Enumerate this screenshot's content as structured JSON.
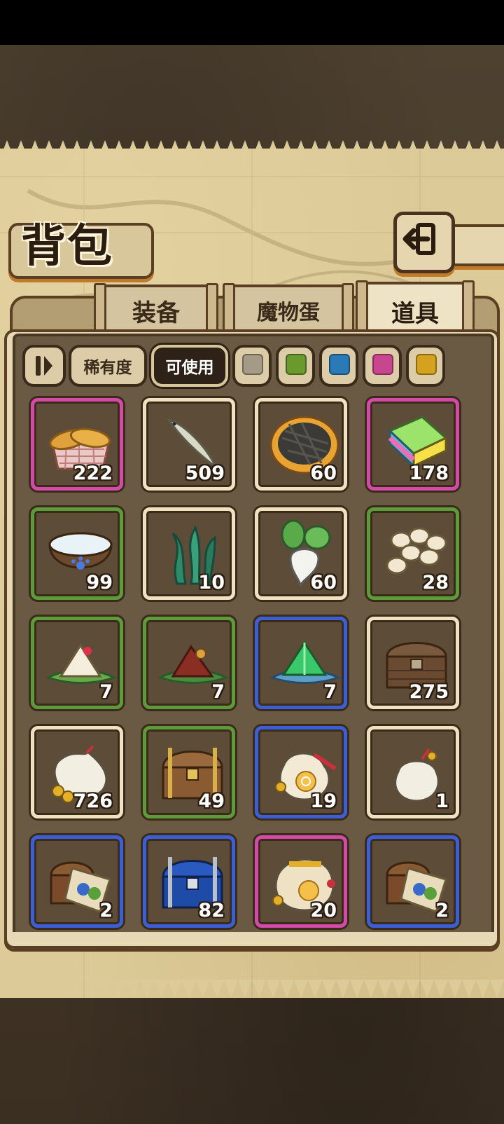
{
  "title": "背包",
  "tabs": [
    {
      "label": "装备",
      "active": false
    },
    {
      "label": "魔物蛋",
      "active": false
    },
    {
      "label": "道具",
      "active": true
    }
  ],
  "filters": {
    "sort_icon": "sort-toggle-icon",
    "rarity_label": "稀有度",
    "usable_label": "可使用",
    "usable_selected": true,
    "rarity_colors": [
      "#a59a86",
      "#6a9a2e",
      "#2a7ab8",
      "#c8468e",
      "#d4a21e"
    ]
  },
  "rarity_border_colors": {
    "common": "#efe2c0",
    "green": "#5d9a3a",
    "blue": "#3d5fd6",
    "pink": "#d44aa8"
  },
  "items": [
    {
      "name": "bread-basket-icon",
      "count": "222",
      "rarity": "pink"
    },
    {
      "name": "fish-icon",
      "count": "509",
      "rarity": "common"
    },
    {
      "name": "pie-icon",
      "count": "60",
      "rarity": "common"
    },
    {
      "name": "rainbow-cake-icon",
      "count": "178",
      "rarity": "pink"
    },
    {
      "name": "water-bowl-icon",
      "count": "99",
      "rarity": "green"
    },
    {
      "name": "seaweed-icon",
      "count": "10",
      "rarity": "common"
    },
    {
      "name": "radish-icon",
      "count": "60",
      "rarity": "common"
    },
    {
      "name": "eggs-icon",
      "count": "28",
      "rarity": "green"
    },
    {
      "name": "rice-dumpling-icon",
      "count": "7",
      "rarity": "green"
    },
    {
      "name": "meat-dumpling-icon",
      "count": "7",
      "rarity": "green"
    },
    {
      "name": "crystal-dumpling-icon",
      "count": "7",
      "rarity": "blue"
    },
    {
      "name": "wooden-chest-icon",
      "count": "275",
      "rarity": "common"
    },
    {
      "name": "coin-sack-icon",
      "count": "726",
      "rarity": "common"
    },
    {
      "name": "treasure-chest-icon",
      "count": "49",
      "rarity": "green"
    },
    {
      "name": "gold-sack-icon",
      "count": "19",
      "rarity": "blue"
    },
    {
      "name": "small-sack-icon",
      "count": "1",
      "rarity": "common"
    },
    {
      "name": "map-chest-icon",
      "count": "2",
      "rarity": "blue"
    },
    {
      "name": "blue-chest-icon",
      "count": "82",
      "rarity": "blue"
    },
    {
      "name": "big-gold-sack-icon",
      "count": "20",
      "rarity": "pink"
    },
    {
      "name": "map-chest-icon",
      "count": "2",
      "rarity": "blue"
    }
  ]
}
